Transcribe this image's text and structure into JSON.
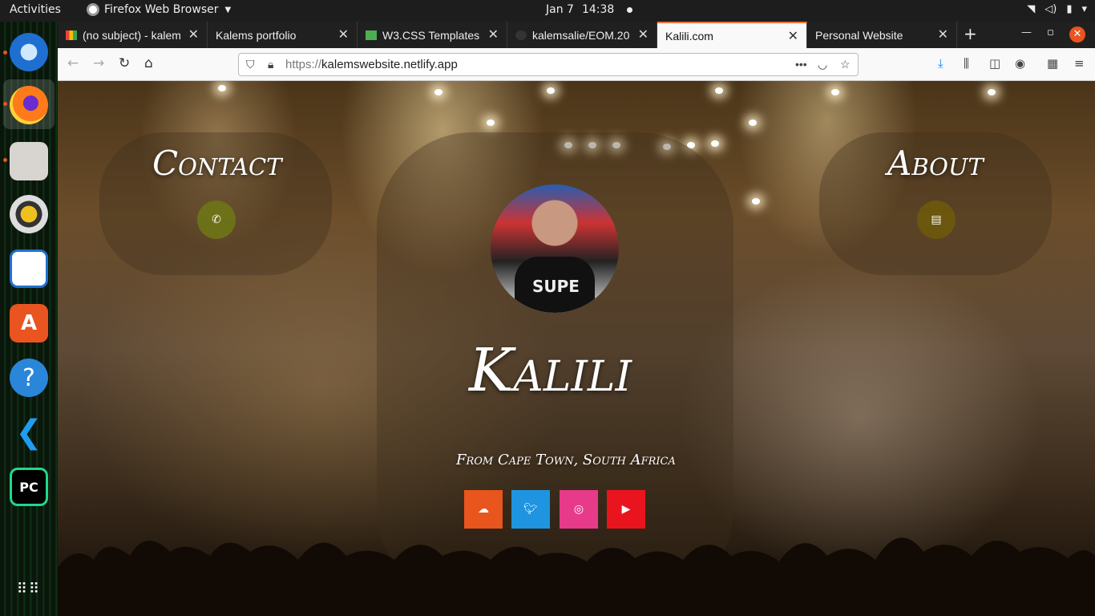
{
  "topbar": {
    "activities": "Activities",
    "app_name": "Firefox Web Browser",
    "date": "Jan 7",
    "time": "14:38"
  },
  "dock": {
    "items": [
      "thunderbird-icon",
      "firefox-icon",
      "files-icon",
      "rhythmbox-icon",
      "writer-icon",
      "software-icon",
      "help-icon",
      "vscode-icon",
      "pycharm-icon",
      "show-apps-icon"
    ]
  },
  "tabs": [
    {
      "label": "(no subject) - kalem"
    },
    {
      "label": "Kalems portfolio"
    },
    {
      "label": "W3.CSS Templates"
    },
    {
      "label": "kalemsalie/EOM.20"
    },
    {
      "label": "Kalili.com"
    },
    {
      "label": "Personal Website"
    }
  ],
  "address_bar": {
    "scheme": "https://",
    "host": "kalemswebsite.netlify.app"
  },
  "page": {
    "contact_heading": "Contact",
    "about_heading": "About",
    "name": "Kalili",
    "tagline": "From Cape Town, South Africa",
    "avatar_shirt_text": "SUPE"
  },
  "colors": {
    "soundcloud": "#e8551d",
    "twitter": "#1f94e0",
    "instagram": "#e73a8b",
    "youtube": "#ea141f",
    "accent": "#ff7139"
  }
}
